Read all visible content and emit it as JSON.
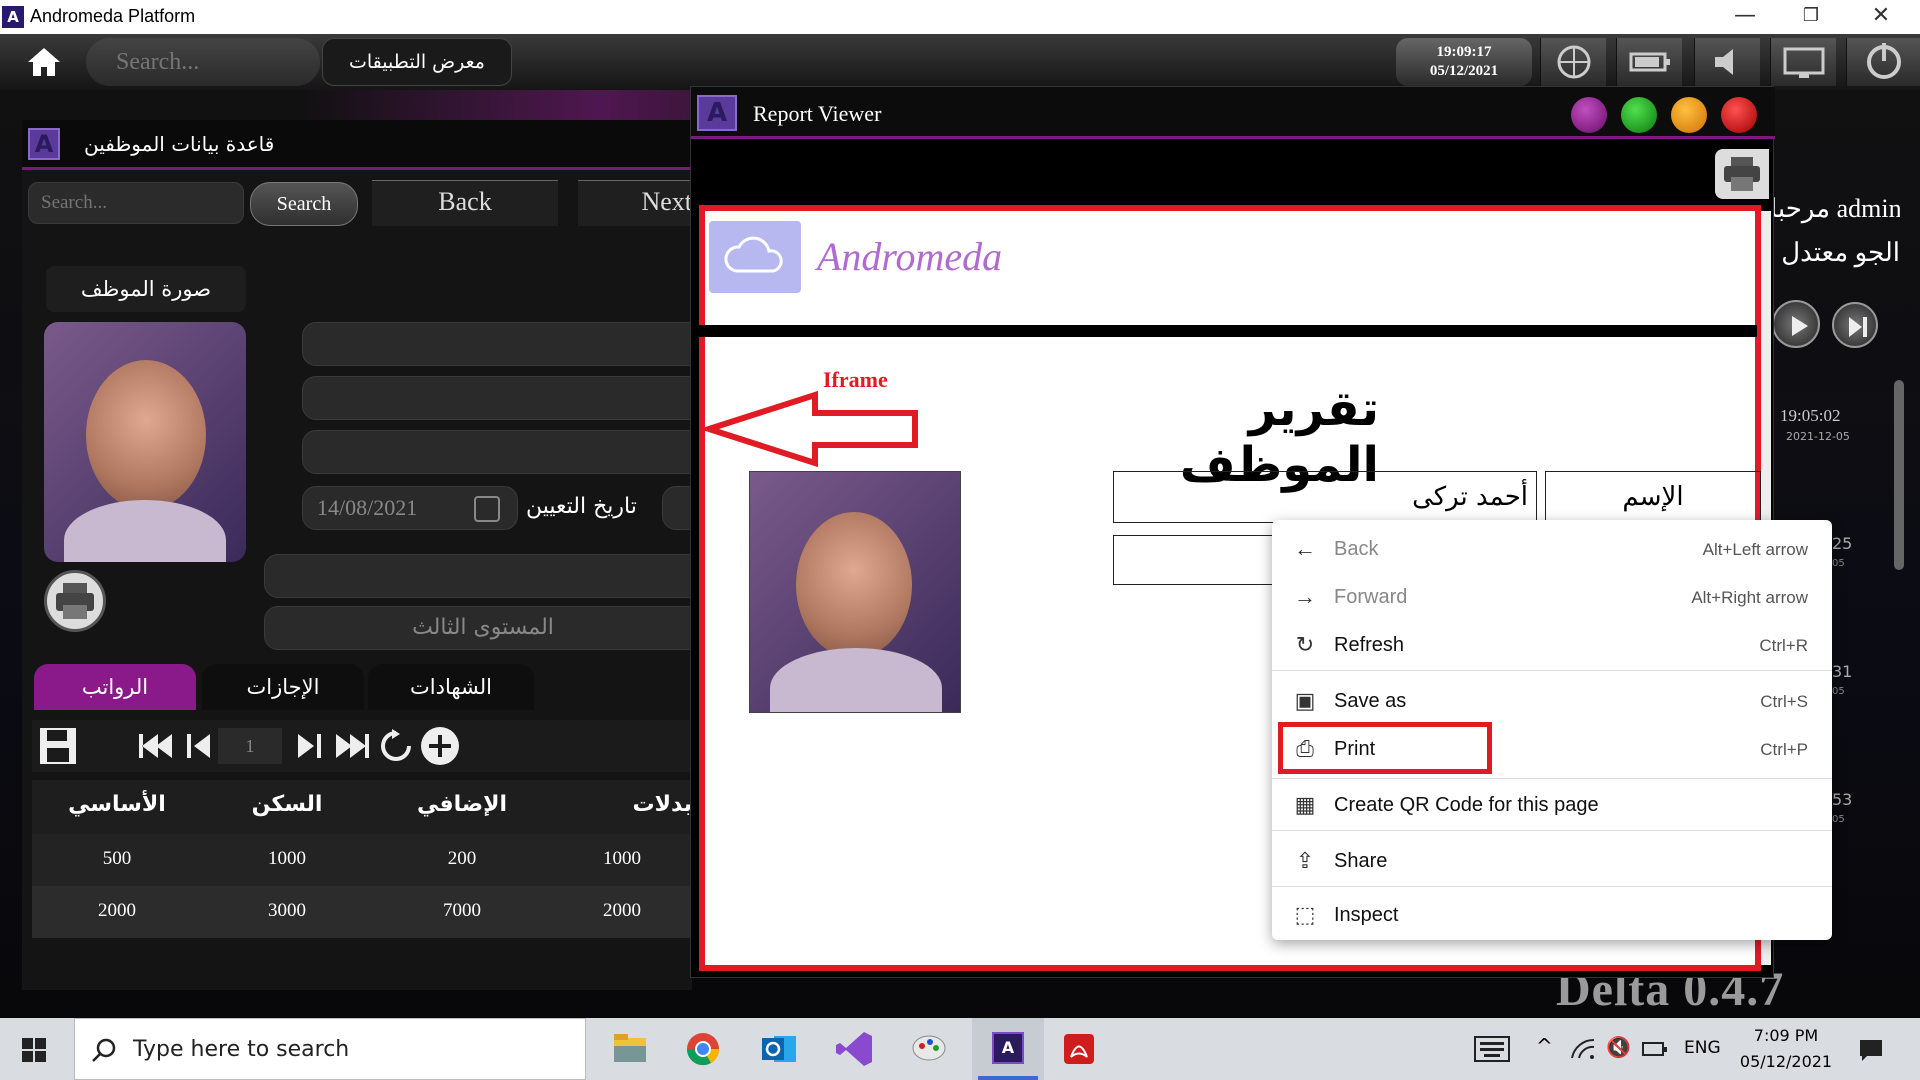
{
  "window": {
    "title": "Andromeda Platform",
    "logo_letter": "A"
  },
  "appbar": {
    "search_placeholder": "Search...",
    "gallery_label": "معرض التطبيقات",
    "time": "19:09:17",
    "date": "05/12/2021"
  },
  "employee_window": {
    "title": "قاعدة بيانات الموظفين",
    "search_placeholder": "Search...",
    "search_button": "Search",
    "back_button": "Back",
    "next_button": "Next",
    "photo_label": "صورة الموظف",
    "hire_date_value": "14/08/2021",
    "hire_date_label": "تاريخ التعيين",
    "level_value": "المستوى الثالث",
    "tabs": [
      "الرواتب",
      "الإجازات",
      "الشهادات"
    ],
    "page_number": "1",
    "grid": {
      "headers": [
        "الأساسي",
        "السكن",
        "الإضافي",
        "بدلات"
      ],
      "rows": [
        [
          "500",
          "1000",
          "200",
          "1000"
        ],
        [
          "2000",
          "3000",
          "7000",
          "2000"
        ]
      ]
    }
  },
  "report_viewer": {
    "title": "Report Viewer",
    "brand": "Andromeda",
    "annotation_label": "Iframe",
    "report_title": "تقرير الموظف",
    "name_label": "الإسم",
    "name_value": "أحمد تركى",
    "dot_colors": [
      "#8b1a8b",
      "#1aa01a",
      "#f0a010",
      "#d01010"
    ]
  },
  "context_menu": {
    "items": [
      {
        "label": "Back",
        "shortcut": "Alt+Left arrow",
        "icon": "arrow-left-icon",
        "disabled": true
      },
      {
        "label": "Forward",
        "shortcut": "Alt+Right arrow",
        "icon": "arrow-right-icon",
        "disabled": true
      },
      {
        "label": "Refresh",
        "shortcut": "Ctrl+R",
        "icon": "refresh-icon",
        "disabled": false
      },
      {
        "label": "Save as",
        "shortcut": "Ctrl+S",
        "icon": "save-as-icon",
        "disabled": false
      },
      {
        "label": "Print",
        "shortcut": "Ctrl+P",
        "icon": "printer-icon",
        "disabled": false
      },
      {
        "label": "Create QR Code for this page",
        "shortcut": "",
        "icon": "qr-code-icon",
        "disabled": false
      },
      {
        "label": "Share",
        "shortcut": "",
        "icon": "share-icon",
        "disabled": false
      },
      {
        "label": "Inspect",
        "shortcut": "",
        "icon": "inspect-icon",
        "disabled": false
      }
    ]
  },
  "desktop": {
    "welcome": "مرحبا admin",
    "weather": "الجو معتدل",
    "time1": "19:05:02",
    "date1": "2021-12-05",
    "num1": "25",
    "num2": "31",
    "num3": "53",
    "small_date": "05",
    "version": "Delta 0.4.7"
  },
  "taskbar": {
    "search_placeholder": "Type here to search",
    "lang": "ENG",
    "time": "7:09 PM",
    "date": "05/12/2021"
  }
}
